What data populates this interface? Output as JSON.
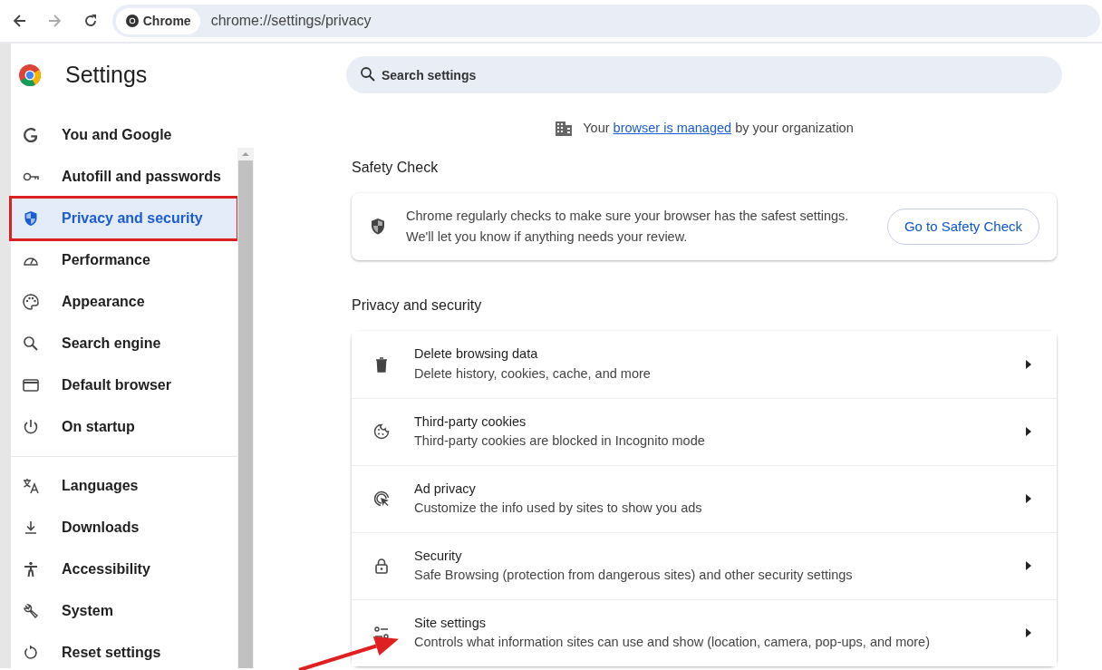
{
  "toolbar": {
    "site_chip": "Chrome",
    "url": "chrome://settings/privacy"
  },
  "sidebar": {
    "title": "Settings",
    "items": [
      {
        "label": "You and Google",
        "selected": false,
        "highlighted": false
      },
      {
        "label": "Autofill and passwords",
        "selected": false,
        "highlighted": false
      },
      {
        "label": "Privacy and security",
        "selected": true,
        "highlighted": true
      },
      {
        "label": "Performance",
        "selected": false,
        "highlighted": false
      },
      {
        "label": "Appearance",
        "selected": false,
        "highlighted": false
      },
      {
        "label": "Search engine",
        "selected": false,
        "highlighted": false
      },
      {
        "label": "Default browser",
        "selected": false,
        "highlighted": false
      },
      {
        "label": "On startup",
        "selected": false,
        "highlighted": false,
        "divider_after": true
      },
      {
        "label": "Languages",
        "selected": false,
        "highlighted": false
      },
      {
        "label": "Downloads",
        "selected": false,
        "highlighted": false
      },
      {
        "label": "Accessibility",
        "selected": false,
        "highlighted": false
      },
      {
        "label": "System",
        "selected": false,
        "highlighted": false
      },
      {
        "label": "Reset settings",
        "selected": false,
        "highlighted": false
      }
    ]
  },
  "search": {
    "placeholder": "Search settings"
  },
  "managed_notice": {
    "before": "Your",
    "link": "browser is managed",
    "after": "by your organization"
  },
  "safety_check": {
    "heading": "Safety Check",
    "lines": [
      "Chrome regularly checks to make sure your browser has the safest settings.",
      "We'll let you know if anything needs your review."
    ],
    "button": "Go to Safety Check"
  },
  "privacy": {
    "heading": "Privacy and security",
    "rows": [
      {
        "title": "Delete browsing data",
        "subtitle": "Delete history, cookies, cache, and more",
        "pointed_at": false
      },
      {
        "title": "Third-party cookies",
        "subtitle": "Third-party cookies are blocked in Incognito mode",
        "pointed_at": false
      },
      {
        "title": "Ad privacy",
        "subtitle": "Customize the info used by sites to show you ads",
        "pointed_at": false
      },
      {
        "title": "Security",
        "subtitle": "Safe Browsing (protection from dangerous sites) and other security settings",
        "pointed_at": false
      },
      {
        "title": "Site settings",
        "subtitle": "Controls what information sites can use and show (location, camera, pop-ups, and more)",
        "pointed_at": true
      }
    ]
  }
}
